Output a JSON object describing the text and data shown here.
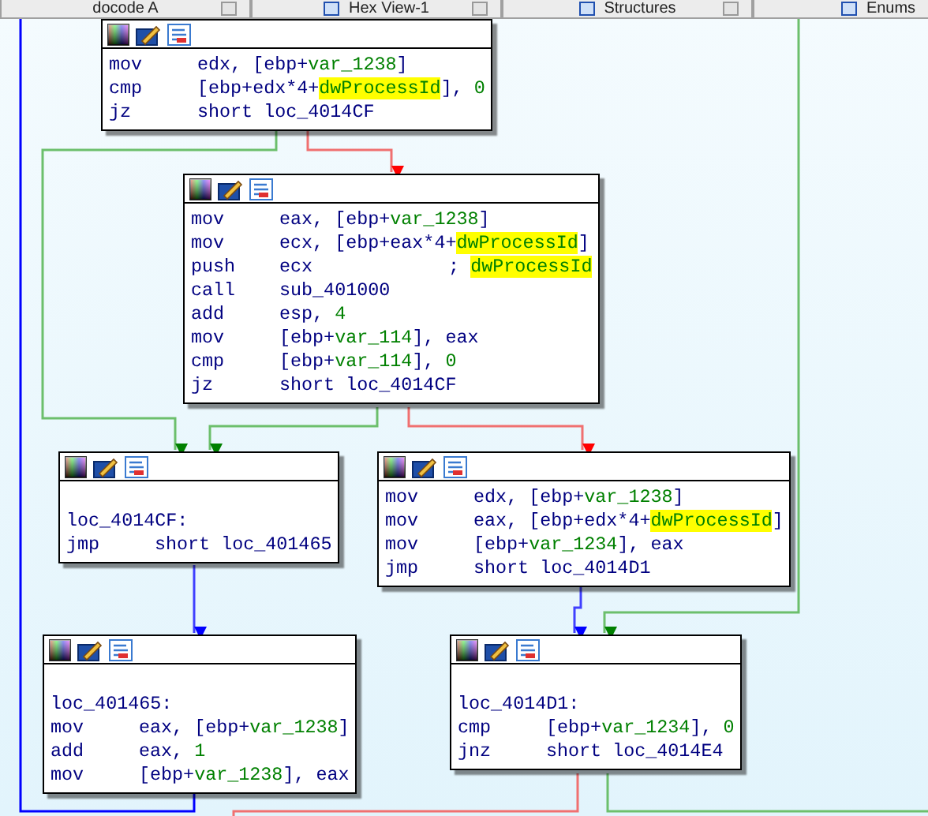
{
  "tabs": [
    {
      "label": "docode A",
      "selected": false,
      "icon": false
    },
    {
      "label": "Hex View-1",
      "selected": false,
      "icon": true
    },
    {
      "label": "Structures",
      "selected": false,
      "icon": true
    },
    {
      "label": "Enums",
      "selected": false,
      "icon": true
    }
  ],
  "blocks": [
    {
      "lines": [
        {
          "kind": "instr",
          "mnemonic": "mov",
          "parts": [
            {
              "kind": "plain",
              "text": "edx, [ebp+"
            },
            {
              "kind": "var",
              "text": "var_1238"
            },
            {
              "kind": "plain",
              "text": "]"
            }
          ]
        },
        {
          "kind": "instr",
          "mnemonic": "cmp",
          "parts": [
            {
              "kind": "plain",
              "text": "[ebp+edx*4+"
            },
            {
              "kind": "highlight",
              "text": "dwProcessId"
            },
            {
              "kind": "plain",
              "text": "], "
            },
            {
              "kind": "var",
              "text": "0"
            }
          ]
        },
        {
          "kind": "instr",
          "mnemonic": "jz",
          "parts": [
            {
              "kind": "plain",
              "text": "short loc_4014CF"
            }
          ]
        }
      ]
    },
    {
      "lines": [
        {
          "kind": "instr",
          "mnemonic": "mov",
          "parts": [
            {
              "kind": "plain",
              "text": "eax, [ebp+"
            },
            {
              "kind": "var",
              "text": "var_1238"
            },
            {
              "kind": "plain",
              "text": "]"
            }
          ]
        },
        {
          "kind": "instr",
          "mnemonic": "mov",
          "parts": [
            {
              "kind": "plain",
              "text": "ecx, [ebp+eax*4+"
            },
            {
              "kind": "highlight",
              "text": "dwProcessId"
            },
            {
              "kind": "plain",
              "text": "]"
            }
          ]
        },
        {
          "kind": "instr",
          "mnemonic": "push",
          "parts": [
            {
              "kind": "plain",
              "text": "ecx"
            }
          ],
          "comment": [
            {
              "kind": "plain",
              "text": "; "
            },
            {
              "kind": "highlight",
              "text": "dwProcessId"
            }
          ]
        },
        {
          "kind": "instr",
          "mnemonic": "call",
          "parts": [
            {
              "kind": "plain",
              "text": "sub_401000"
            }
          ]
        },
        {
          "kind": "instr",
          "mnemonic": "add",
          "parts": [
            {
              "kind": "plain",
              "text": "esp, "
            },
            {
              "kind": "var",
              "text": "4"
            }
          ]
        },
        {
          "kind": "instr",
          "mnemonic": "mov",
          "parts": [
            {
              "kind": "plain",
              "text": "[ebp+"
            },
            {
              "kind": "var",
              "text": "var_114"
            },
            {
              "kind": "plain",
              "text": "], eax"
            }
          ]
        },
        {
          "kind": "instr",
          "mnemonic": "cmp",
          "parts": [
            {
              "kind": "plain",
              "text": "[ebp+"
            },
            {
              "kind": "var",
              "text": "var_114"
            },
            {
              "kind": "plain",
              "text": "], "
            },
            {
              "kind": "var",
              "text": "0"
            }
          ]
        },
        {
          "kind": "instr",
          "mnemonic": "jz",
          "parts": [
            {
              "kind": "plain",
              "text": "short loc_4014CF"
            }
          ]
        }
      ]
    },
    {
      "lines": [
        {
          "kind": "blank"
        },
        {
          "kind": "label",
          "text": "loc_4014CF:"
        },
        {
          "kind": "instr",
          "mnemonic": "jmp",
          "parts": [
            {
              "kind": "plain",
              "text": "short loc_401465"
            }
          ]
        }
      ]
    },
    {
      "lines": [
        {
          "kind": "instr",
          "mnemonic": "mov",
          "parts": [
            {
              "kind": "plain",
              "text": "edx, [ebp+"
            },
            {
              "kind": "var",
              "text": "var_1238"
            },
            {
              "kind": "plain",
              "text": "]"
            }
          ]
        },
        {
          "kind": "instr",
          "mnemonic": "mov",
          "parts": [
            {
              "kind": "plain",
              "text": "eax, [ebp+edx*4+"
            },
            {
              "kind": "highlight",
              "text": "dwProcessId"
            },
            {
              "kind": "plain",
              "text": "]"
            }
          ]
        },
        {
          "kind": "instr",
          "mnemonic": "mov",
          "parts": [
            {
              "kind": "plain",
              "text": "[ebp+"
            },
            {
              "kind": "var",
              "text": "var_1234"
            },
            {
              "kind": "plain",
              "text": "], eax"
            }
          ]
        },
        {
          "kind": "instr",
          "mnemonic": "jmp",
          "parts": [
            {
              "kind": "plain",
              "text": "short loc_4014D1"
            }
          ]
        }
      ]
    },
    {
      "lines": [
        {
          "kind": "blank"
        },
        {
          "kind": "label",
          "text": "loc_401465:"
        },
        {
          "kind": "instr",
          "mnemonic": "mov",
          "parts": [
            {
              "kind": "plain",
              "text": "eax, [ebp+"
            },
            {
              "kind": "var",
              "text": "var_1238"
            },
            {
              "kind": "plain",
              "text": "]"
            }
          ]
        },
        {
          "kind": "instr",
          "mnemonic": "add",
          "parts": [
            {
              "kind": "plain",
              "text": "eax, "
            },
            {
              "kind": "var",
              "text": "1"
            }
          ]
        },
        {
          "kind": "instr",
          "mnemonic": "mov",
          "parts": [
            {
              "kind": "plain",
              "text": "[ebp+"
            },
            {
              "kind": "var",
              "text": "var_1238"
            },
            {
              "kind": "plain",
              "text": "], eax"
            }
          ]
        }
      ]
    },
    {
      "lines": [
        {
          "kind": "blank"
        },
        {
          "kind": "label",
          "text": "loc_4014D1:"
        },
        {
          "kind": "instr",
          "mnemonic": "cmp",
          "parts": [
            {
              "kind": "plain",
              "text": "[ebp+"
            },
            {
              "kind": "var",
              "text": "var_1234"
            },
            {
              "kind": "plain",
              "text": "], "
            },
            {
              "kind": "var",
              "text": "0"
            }
          ]
        },
        {
          "kind": "instr",
          "mnemonic": "jnz",
          "parts": [
            {
              "kind": "plain",
              "text": "short loc_4014E4"
            }
          ]
        }
      ]
    }
  ]
}
